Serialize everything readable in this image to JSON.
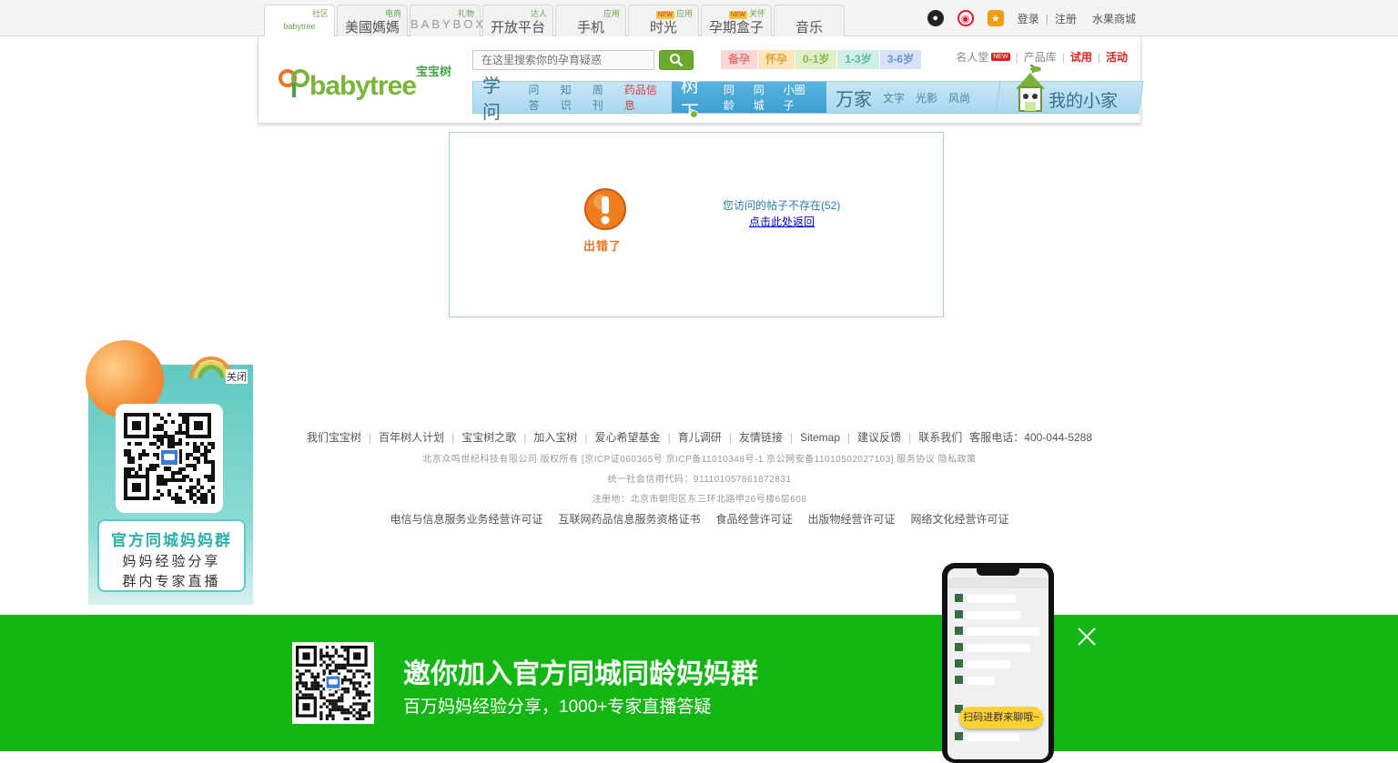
{
  "topbar": {
    "tabs": [
      {
        "label": "babytree",
        "sup": "社区",
        "sup_new": ""
      },
      {
        "label": "美國媽媽",
        "sup": "电商",
        "sup_new": ""
      },
      {
        "label": "BABYBOX",
        "sup": "礼物",
        "sup_new": ""
      },
      {
        "label": "开放平台",
        "sup": "达人",
        "sup_new": ""
      },
      {
        "label": "手机",
        "sup": "应用",
        "sup_new": ""
      },
      {
        "label": "时光",
        "sup": "应用",
        "sup_new": "NEW"
      },
      {
        "label": "孕期盒子",
        "sup": "关怀",
        "sup_new": "NEW"
      },
      {
        "label": "音乐",
        "sup": "",
        "sup_new": ""
      }
    ],
    "login": "登录",
    "register": "注册",
    "fruit_mall": "水果商城"
  },
  "header": {
    "logo_cn": "宝宝树",
    "logo_en": "babytree",
    "search_placeholder": "在这里搜索你的孕育疑惑",
    "stages": [
      "备孕",
      "怀孕",
      "0-1岁",
      "1-3岁",
      "3-6岁"
    ],
    "links": {
      "hall_of_fame": "名人堂",
      "new_badge": "NEW",
      "products": "产品库",
      "trial": "试用",
      "events": "活动"
    },
    "nav": {
      "xuewen": {
        "title": "学问",
        "items": [
          "问答",
          "知识",
          "周刊",
          "药品信息"
        ]
      },
      "shuxia": {
        "title": "树下",
        "items": [
          "同龄",
          "同城",
          "小圈子"
        ]
      },
      "wanjia": {
        "title": "万家",
        "items": [
          "文字",
          "光影",
          "风尚"
        ]
      }
    },
    "my_home": "我的小家"
  },
  "error": {
    "badge_text": "出错了",
    "message": "您访问的帖子不存在(52)",
    "back_link": "点击此处返回"
  },
  "footer": {
    "links": [
      "我们宝宝树",
      "百年树人计划",
      "宝宝树之歌",
      "加入宝树",
      "爱心希望基金",
      "育儿调研",
      "友情链接",
      "Sitemap",
      "建议反馈",
      "联系我们"
    ],
    "hotline": "客服电话：400-044-5288",
    "company_line": "北京众鸣世纪科技有限公司 版权所有 [京ICP证060365号 京ICP备11010348号-1 京公网安备11010502027103] 服务协议 隐私政策",
    "credit_code": "统一社会信用代码：911101057861872831",
    "address": "注册地：北京市朝阳区东三环北路甲26号楼6层608",
    "permits": [
      "电信与信息服务业务经营许可证",
      "互联网药品信息服务资格证书",
      "食品经营许可证",
      "出版物经营许可证",
      "网络文化经营许可证"
    ]
  },
  "float_ad": {
    "close": "关闭",
    "title": "官方同城妈妈群",
    "line1": "妈妈经验分享",
    "line2": "群内专家直播"
  },
  "bottom_banner": {
    "title": "邀你加入官方同城同龄妈妈群",
    "subtitle": "百万妈妈经验分享，1000+专家直播答疑",
    "phone_bubble": "扫码进群来聊哦~"
  }
}
